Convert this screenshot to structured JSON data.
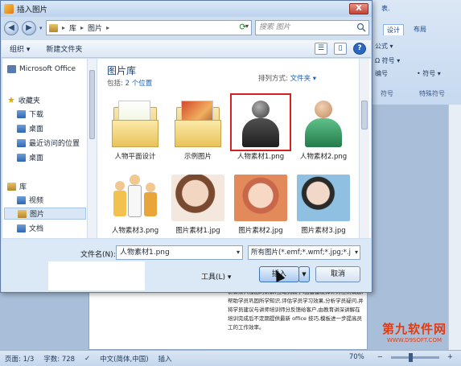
{
  "dialog": {
    "title": "插入图片",
    "close_label": "X",
    "address": {
      "segments": [
        "库",
        "图片"
      ]
    },
    "search_placeholder": "搜索 图片",
    "toolbar": {
      "organize": "组织 ▾",
      "new_folder": "新建文件夹",
      "help": "?"
    },
    "sidebar": {
      "items": [
        {
          "label": "Microsoft Office",
          "icon": "computer-icon"
        },
        {
          "label": "收藏夹",
          "icon": "star-icon"
        },
        {
          "label": "下载",
          "icon": "folder-icon"
        },
        {
          "label": "桌面",
          "icon": "desktop-icon"
        },
        {
          "label": "最近访问的位置",
          "icon": "recent-icon"
        },
        {
          "label": "桌面",
          "icon": "desktop-icon"
        },
        {
          "label": "库",
          "icon": "library-icon"
        },
        {
          "label": "视频",
          "icon": "video-icon"
        },
        {
          "label": "图片",
          "icon": "pictures-icon"
        },
        {
          "label": "文档",
          "icon": "documents-icon"
        }
      ]
    },
    "library": {
      "title": "图片库",
      "includes_label": "包括:",
      "includes_link": "2 个位置",
      "arrange_label": "排列方式:",
      "arrange_value": "文件夹 ▾"
    },
    "thumbnails": [
      {
        "caption": "人物平面设计",
        "kind": "folder"
      },
      {
        "caption": "示例图片",
        "kind": "folder"
      },
      {
        "caption": "人物素材1.png",
        "kind": "person",
        "selected": true
      },
      {
        "caption": "人物素材2.png",
        "kind": "person"
      },
      {
        "caption": "人物素材3.png",
        "kind": "people"
      },
      {
        "caption": "图片素材1.jpg",
        "kind": "photo"
      },
      {
        "caption": "图片素材2.jpg",
        "kind": "photo"
      },
      {
        "caption": "图片素材3.jpg",
        "kind": "photo"
      }
    ],
    "footer": {
      "filename_label": "文件名(N):",
      "filename_value": "人物素材1.png",
      "filter_value": "所有图片(*.emf;*.wmf;*.jpg;*.j",
      "tools_label": "工具(L) ▾",
      "insert_label": "插入",
      "cancel_label": "取消"
    }
  },
  "word": {
    "ribbon_tabs": [
      "表.",
      "设计",
      "布局"
    ],
    "ribbon_controls": [
      "公式 ▾",
      "Ω 符号 ▾",
      "编号",
      "• 符号 ▾"
    ],
    "ribbon_groups": [
      "符号",
      "特殊符号"
    ],
    "doc_text": "讲课深入浅出的讲解,互动式教学,由富富发挥计对性测试题,帮助学员巩固所学知识,评估学员学习效果,分析学员疑问,并将学员建议与讲师培训师分反馈给客户,由教育讲深讲解在培训完成后不定期提供最新 office 技巧,模板进一步提高员工的工作效率。",
    "status": {
      "page": "页面: 1/3",
      "words": "字数: 728",
      "lang": "中文(简体,中国)",
      "mode": "插入",
      "zoom": "70%"
    },
    "watermark": {
      "line1": "第九软件网",
      "line2": "WWW.D9SOFT.COM"
    }
  }
}
